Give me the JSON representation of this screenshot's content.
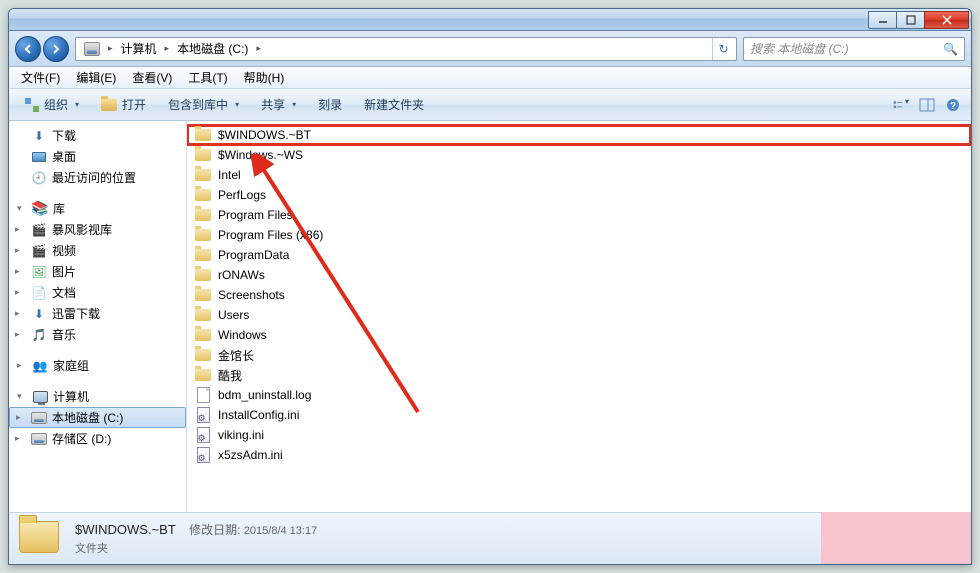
{
  "titlebar": {},
  "nav": {
    "breadcrumb": [
      {
        "label": "计算机"
      },
      {
        "label": "本地磁盘 (C:)"
      }
    ],
    "search_placeholder": "搜索 本地磁盘 (C:)"
  },
  "menubar": [
    "文件(F)",
    "编辑(E)",
    "查看(V)",
    "工具(T)",
    "帮助(H)"
  ],
  "toolbar": {
    "organize": "组织",
    "open": "打开",
    "include": "包含到库中",
    "share": "共享",
    "burn": "刻录",
    "newfolder": "新建文件夹"
  },
  "tree": {
    "items": [
      {
        "type": "node",
        "label": "下载",
        "icon": "dl"
      },
      {
        "type": "node",
        "label": "桌面",
        "icon": "desk"
      },
      {
        "type": "node",
        "label": "最近访问的位置",
        "icon": "recent"
      },
      {
        "type": "sep"
      },
      {
        "type": "group",
        "label": "库",
        "icon": "lib",
        "arrow": "▾"
      },
      {
        "type": "node",
        "label": "暴风影视库",
        "icon": "video",
        "arrow": "▸"
      },
      {
        "type": "node",
        "label": "视频",
        "icon": "video",
        "arrow": "▸"
      },
      {
        "type": "node",
        "label": "图片",
        "icon": "pic",
        "arrow": "▸"
      },
      {
        "type": "node",
        "label": "文档",
        "icon": "doc",
        "arrow": "▸"
      },
      {
        "type": "node",
        "label": "迅雷下载",
        "icon": "dl",
        "arrow": "▸"
      },
      {
        "type": "node",
        "label": "音乐",
        "icon": "music",
        "arrow": "▸"
      },
      {
        "type": "sep"
      },
      {
        "type": "group",
        "label": "家庭组",
        "icon": "hg",
        "arrow": "▸"
      },
      {
        "type": "sep"
      },
      {
        "type": "group",
        "label": "计算机",
        "icon": "pc",
        "arrow": "▾"
      },
      {
        "type": "node",
        "label": "本地磁盘 (C:)",
        "icon": "drive",
        "sel": true,
        "arrow": "▸"
      },
      {
        "type": "node",
        "label": "存储区 (D:)",
        "icon": "drive",
        "arrow": "▸"
      }
    ]
  },
  "files": [
    {
      "name": "$WINDOWS.~BT",
      "type": "folder",
      "hl": true
    },
    {
      "name": "$Windows.~WS",
      "type": "folder"
    },
    {
      "name": "Intel",
      "type": "folder"
    },
    {
      "name": "PerfLogs",
      "type": "folder"
    },
    {
      "name": "Program Files",
      "type": "folder"
    },
    {
      "name": "Program Files (x86)",
      "type": "folder"
    },
    {
      "name": "ProgramData",
      "type": "folder"
    },
    {
      "name": "rONAWs",
      "type": "folder"
    },
    {
      "name": "Screenshots",
      "type": "folder"
    },
    {
      "name": "Users",
      "type": "folder"
    },
    {
      "name": "Windows",
      "type": "folder"
    },
    {
      "name": "金馆长",
      "type": "folder"
    },
    {
      "name": "酷我",
      "type": "folder"
    },
    {
      "name": "bdm_uninstall.log",
      "type": "file"
    },
    {
      "name": "InstallConfig.ini",
      "type": "ini"
    },
    {
      "name": "viking.ini",
      "type": "ini"
    },
    {
      "name": "x5zsAdm.ini",
      "type": "ini"
    }
  ],
  "details": {
    "name": "$WINDOWS.~BT",
    "type_label": "文件夹",
    "moddate_label": "修改日期:",
    "moddate": "2015/8/4 13:17"
  }
}
